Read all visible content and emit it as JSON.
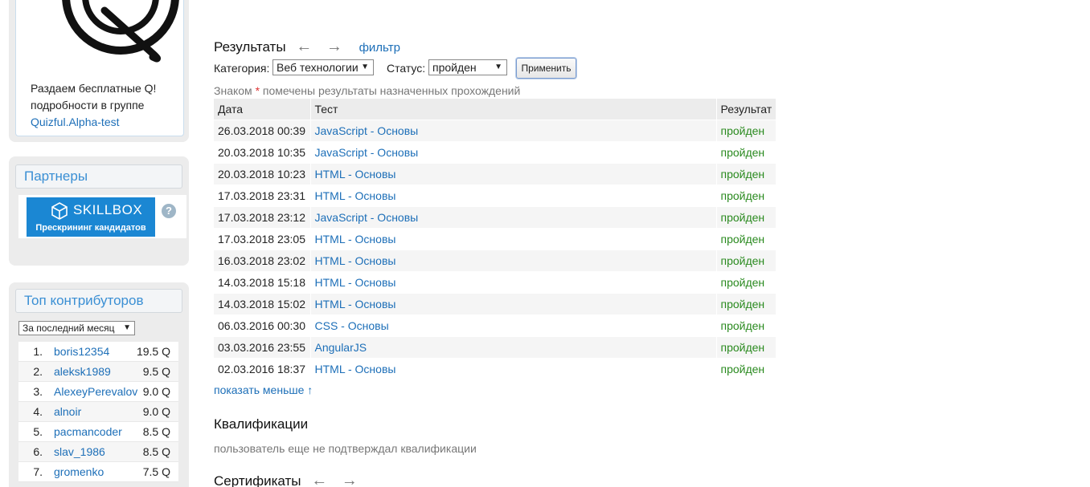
{
  "sidebar": {
    "promo": {
      "text_line1": "Раздаем бесплатные Q!",
      "text_line2": "подробности в группе",
      "link": "Quizful.Alpha-test"
    },
    "partners": {
      "title": "Партнеры",
      "banner_name": "SKILLBOX",
      "banner_sub": "Прескрининг кандидатов",
      "help": "?"
    },
    "contributors": {
      "title": "Топ контрибуторов",
      "period": "За последний месяц",
      "items": [
        {
          "rank": "1.",
          "user": "boris12354",
          "score": "19.5 Q"
        },
        {
          "rank": "2.",
          "user": "aleksk1989",
          "score": "9.5 Q"
        },
        {
          "rank": "3.",
          "user": "AlexeyPerevalov",
          "score": "9.0 Q"
        },
        {
          "rank": "4.",
          "user": "alnoir",
          "score": "9.0 Q"
        },
        {
          "rank": "5.",
          "user": "pacmancoder",
          "score": "8.5 Q"
        },
        {
          "rank": "6.",
          "user": "slav_1986",
          "score": "8.5 Q"
        },
        {
          "rank": "7.",
          "user": "gromenko",
          "score": "7.5 Q"
        }
      ]
    }
  },
  "results": {
    "title": "Результаты",
    "arrows": "← →",
    "filter_link": "фильтр",
    "category_label": "Категория:",
    "category_value": "Веб технологии",
    "status_label": "Статус:",
    "status_value": "пройден",
    "apply": "Применить",
    "note_before": "Знаком ",
    "note_star": "*",
    "note_after": " помечены результаты назначенных прохождений",
    "headers": {
      "date": "Дата",
      "test": "Тест",
      "result": "Результат"
    },
    "rows": [
      {
        "date": "26.03.2018 00:39",
        "test": "JavaScript - Основы",
        "result": "пройден"
      },
      {
        "date": "20.03.2018 10:35",
        "test": "JavaScript - Основы",
        "result": "пройден"
      },
      {
        "date": "20.03.2018 10:23",
        "test": "HTML - Основы",
        "result": "пройден"
      },
      {
        "date": "17.03.2018 23:31",
        "test": "HTML - Основы",
        "result": "пройден"
      },
      {
        "date": "17.03.2018 23:12",
        "test": "JavaScript - Основы",
        "result": "пройден"
      },
      {
        "date": "17.03.2018 23:05",
        "test": "HTML - Основы",
        "result": "пройден"
      },
      {
        "date": "16.03.2018 23:02",
        "test": "HTML - Основы",
        "result": "пройден"
      },
      {
        "date": "14.03.2018 15:18",
        "test": "HTML - Основы",
        "result": "пройден"
      },
      {
        "date": "14.03.2018 15:02",
        "test": "HTML - Основы",
        "result": "пройден"
      },
      {
        "date": "06.03.2016 00:30",
        "test": "CSS - Основы",
        "result": "пройден"
      },
      {
        "date": "03.03.2016 23:55",
        "test": "AngularJS",
        "result": "пройден"
      },
      {
        "date": "02.03.2016 18:37",
        "test": "HTML - Основы",
        "result": "пройден"
      }
    ],
    "show_less": "показать меньше ↑"
  },
  "qualifications": {
    "title": "Квалификации",
    "empty": "пользователь еще не подтверждал квалификации"
  },
  "certificates": {
    "title": "Сертификаты",
    "arrows": "← →"
  },
  "colors": {
    "link": "#1d6fb8",
    "pass": "#2a8a1f",
    "box_title": "#3a8fd4",
    "banner": "#1b87d3"
  }
}
